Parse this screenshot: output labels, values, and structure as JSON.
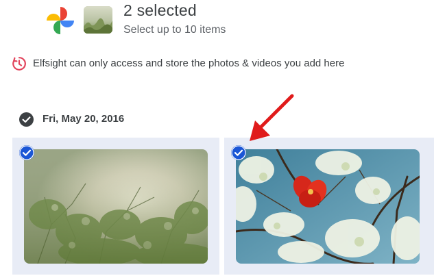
{
  "header": {
    "logo_icon": "google-photos-logo",
    "selected_count_label": "2 selected",
    "limit_label": "Select up to 10 items"
  },
  "notice": {
    "icon": "elfsight-access-icon",
    "text": "Elfsight can only access and store the photos & videos you add here"
  },
  "group": {
    "date_label": "Fri, May 20, 2016",
    "photos": [
      {
        "description_icon": "blossom-tree-sky-photo",
        "selected": true
      },
      {
        "description_icon": "red-flower-blossom-photo",
        "selected": true
      }
    ]
  },
  "colors": {
    "check_blue": "#1a56d6",
    "annotation_red": "#e01b1b",
    "tile_bg": "#e8ecf6",
    "notice_icon": "#e2445c"
  }
}
